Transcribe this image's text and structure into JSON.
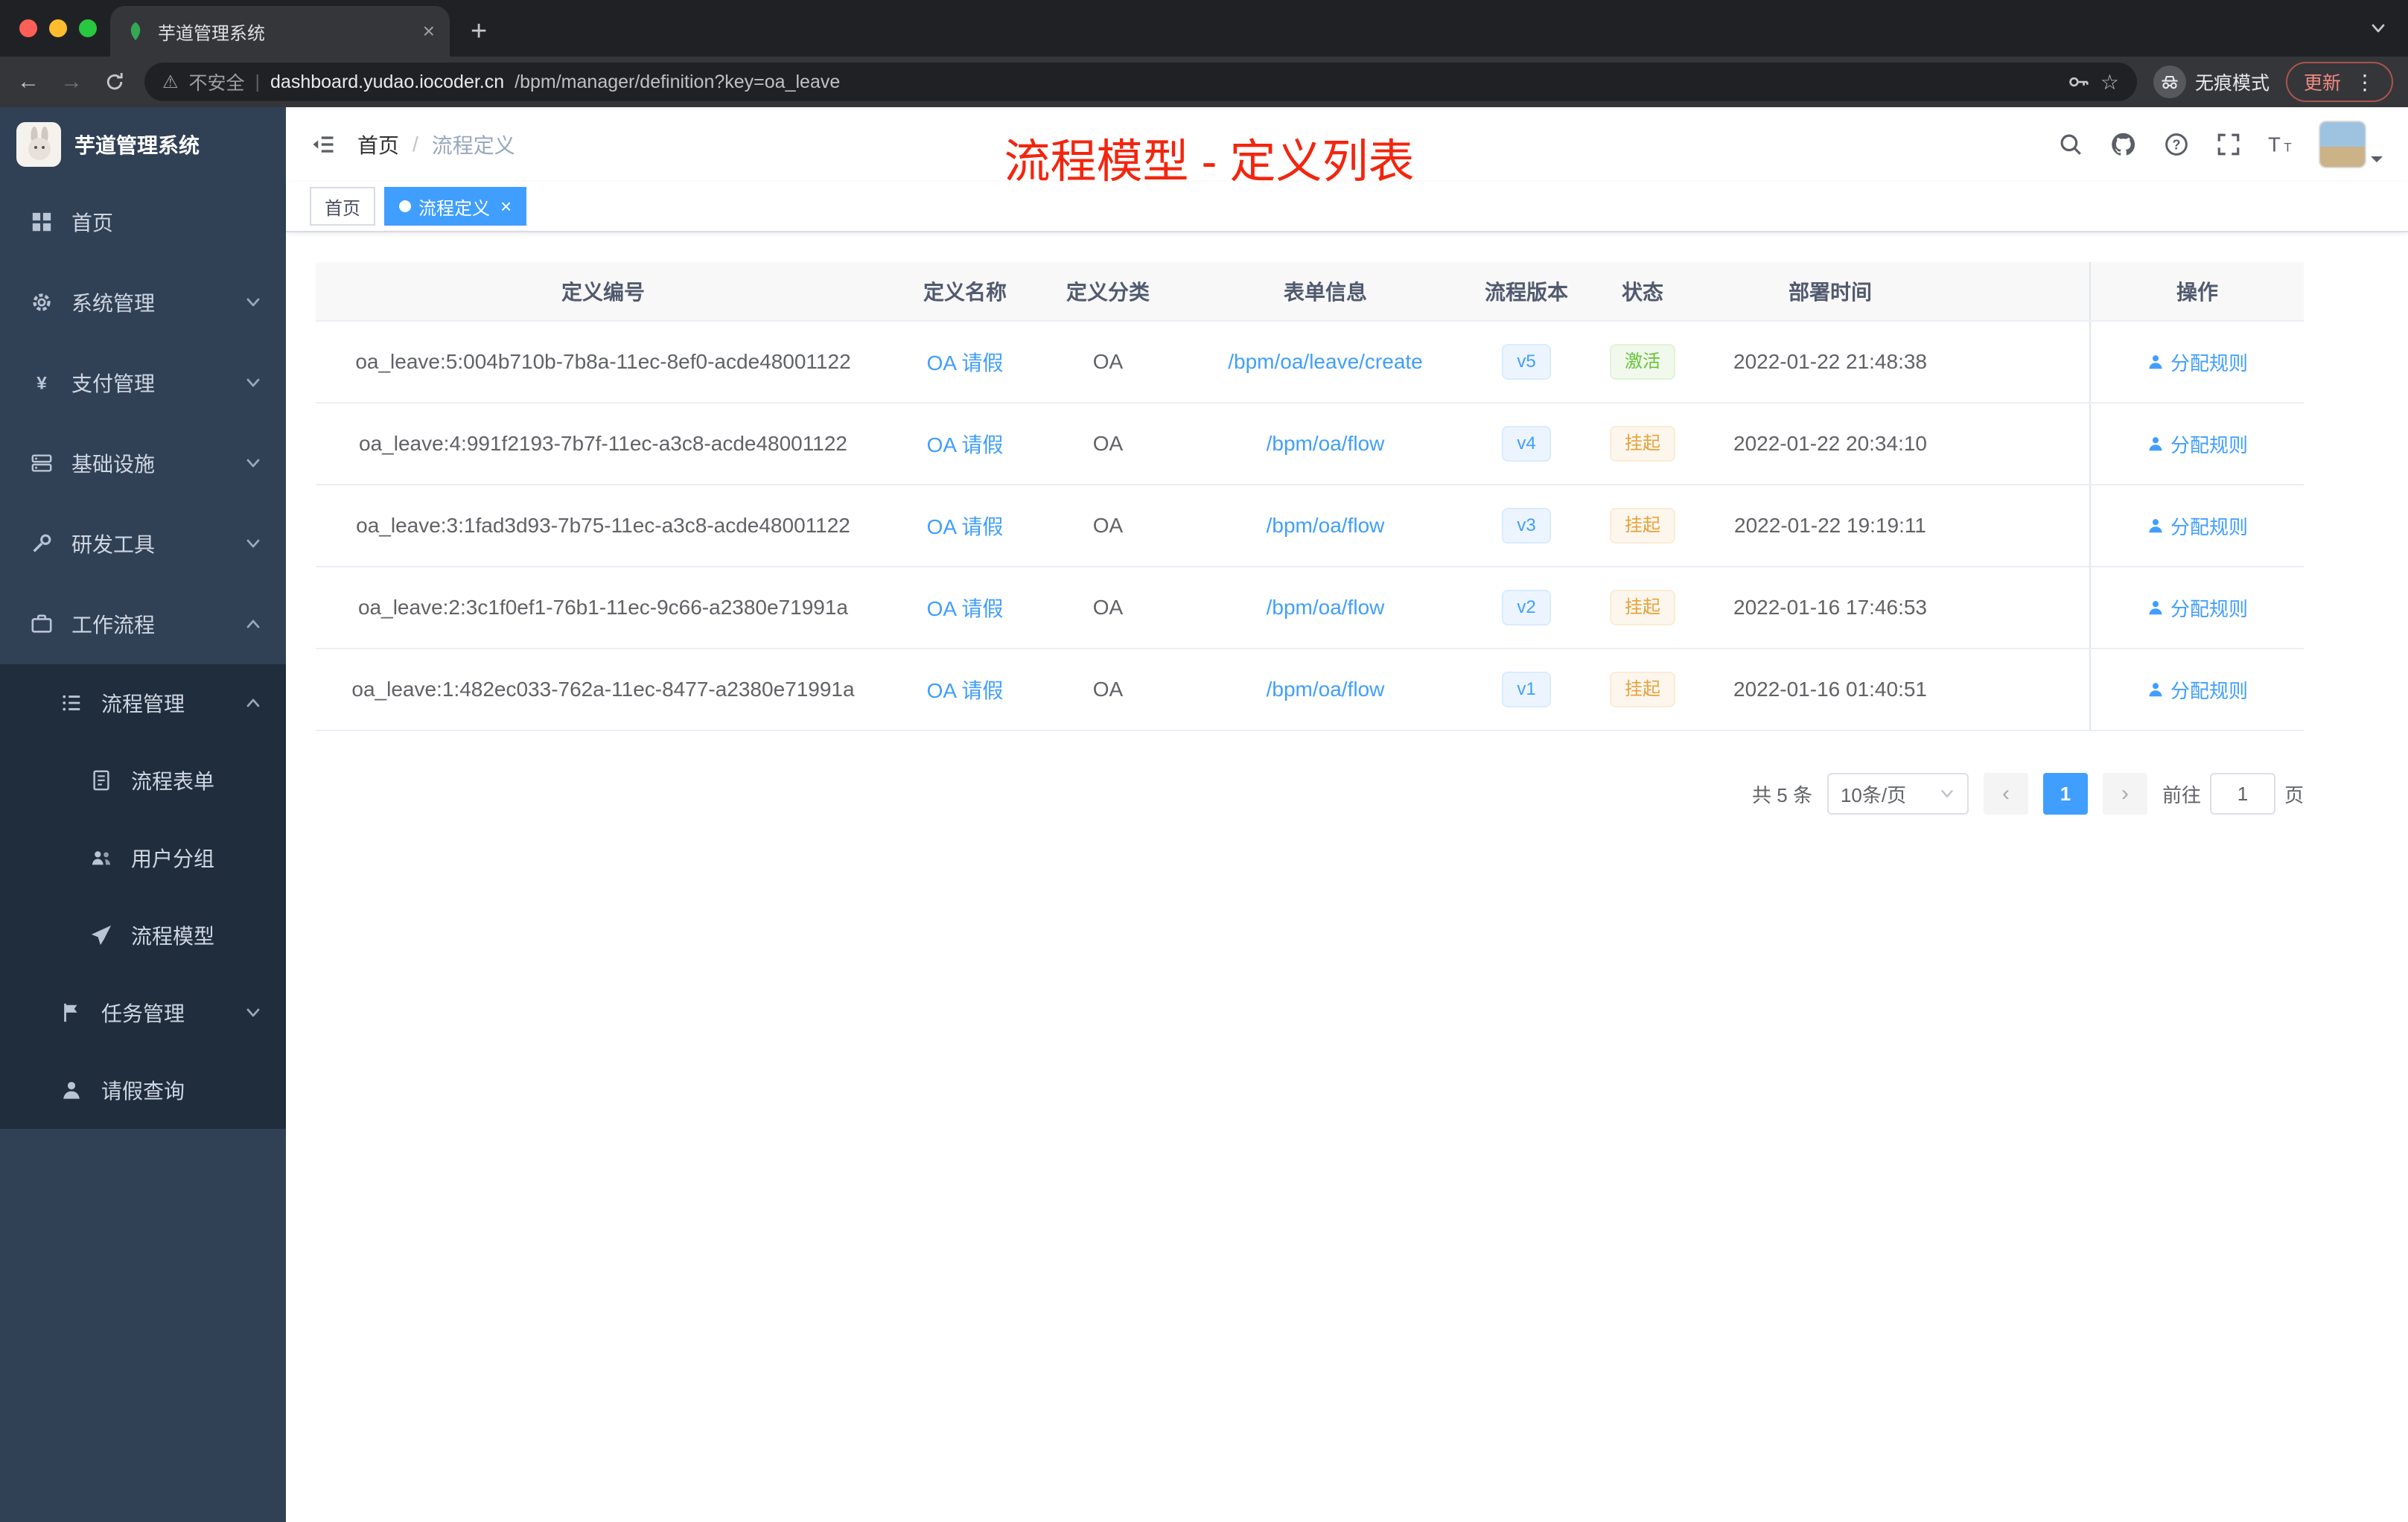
{
  "browser": {
    "tab": {
      "title": "芋道管理系统"
    },
    "toolbar": {
      "security_label": "不安全",
      "url_host": "dashboard.yudao.iocoder.cn",
      "url_path": "/bpm/manager/definition?key=oa_leave",
      "incognito_label": "无痕模式",
      "update_label": "更新"
    }
  },
  "sidebar": {
    "brand": "芋道管理系统",
    "menu": [
      {
        "label": "首页"
      },
      {
        "label": "系统管理"
      },
      {
        "label": "支付管理"
      },
      {
        "label": "基础设施"
      },
      {
        "label": "研发工具"
      },
      {
        "label": "工作流程"
      },
      {
        "label": "流程管理"
      },
      {
        "label": "流程表单"
      },
      {
        "label": "用户分组"
      },
      {
        "label": "流程模型"
      },
      {
        "label": "任务管理"
      },
      {
        "label": "请假查询"
      }
    ]
  },
  "navbar": {
    "breadcrumb": {
      "home": "首页",
      "current": "流程定义"
    },
    "annotation": "流程模型 - 定义列表"
  },
  "tags": [
    {
      "label": "首页",
      "active": false
    },
    {
      "label": "流程定义",
      "active": true
    }
  ],
  "table": {
    "columns": [
      "定义编号",
      "定义名称",
      "定义分类",
      "表单信息",
      "流程版本",
      "状态",
      "部署时间",
      "操作"
    ],
    "rows": [
      {
        "id": "oa_leave:5:004b710b-7b8a-11ec-8ef0-acde48001122",
        "name": "OA 请假",
        "category": "OA",
        "form": "/bpm/oa/leave/create",
        "version": "v5",
        "status": "激活",
        "status_type": "success",
        "deploy_time": "2022-01-22 21:48:38",
        "action": "分配规则"
      },
      {
        "id": "oa_leave:4:991f2193-7b7f-11ec-a3c8-acde48001122",
        "name": "OA 请假",
        "category": "OA",
        "form": "/bpm/oa/flow",
        "version": "v4",
        "status": "挂起",
        "status_type": "warning",
        "deploy_time": "2022-01-22 20:34:10",
        "action": "分配规则"
      },
      {
        "id": "oa_leave:3:1fad3d93-7b75-11ec-a3c8-acde48001122",
        "name": "OA 请假",
        "category": "OA",
        "form": "/bpm/oa/flow",
        "version": "v3",
        "status": "挂起",
        "status_type": "warning",
        "deploy_time": "2022-01-22 19:19:11",
        "action": "分配规则"
      },
      {
        "id": "oa_leave:2:3c1f0ef1-76b1-11ec-9c66-a2380e71991a",
        "name": "OA 请假",
        "category": "OA",
        "form": "/bpm/oa/flow",
        "version": "v2",
        "status": "挂起",
        "status_type": "warning",
        "deploy_time": "2022-01-16 17:46:53",
        "action": "分配规则"
      },
      {
        "id": "oa_leave:1:482ec033-762a-11ec-8477-a2380e71991a",
        "name": "OA 请假",
        "category": "OA",
        "form": "/bpm/oa/flow",
        "version": "v1",
        "status": "挂起",
        "status_type": "warning",
        "deploy_time": "2022-01-16 01:40:51",
        "action": "分配规则"
      }
    ]
  },
  "pagination": {
    "total_label": "共 5 条",
    "page_size_label": "10条/页",
    "current_page": "1",
    "goto_label": "前往",
    "goto_value": "1",
    "page_unit": "页"
  },
  "colors": {
    "accent": "#409eff",
    "success": "#67c23a",
    "warning": "#e6a23c",
    "annotation_red": "#f3250e",
    "sidebar_bg": "#304156",
    "submenu_bg": "#1f2d3d"
  }
}
